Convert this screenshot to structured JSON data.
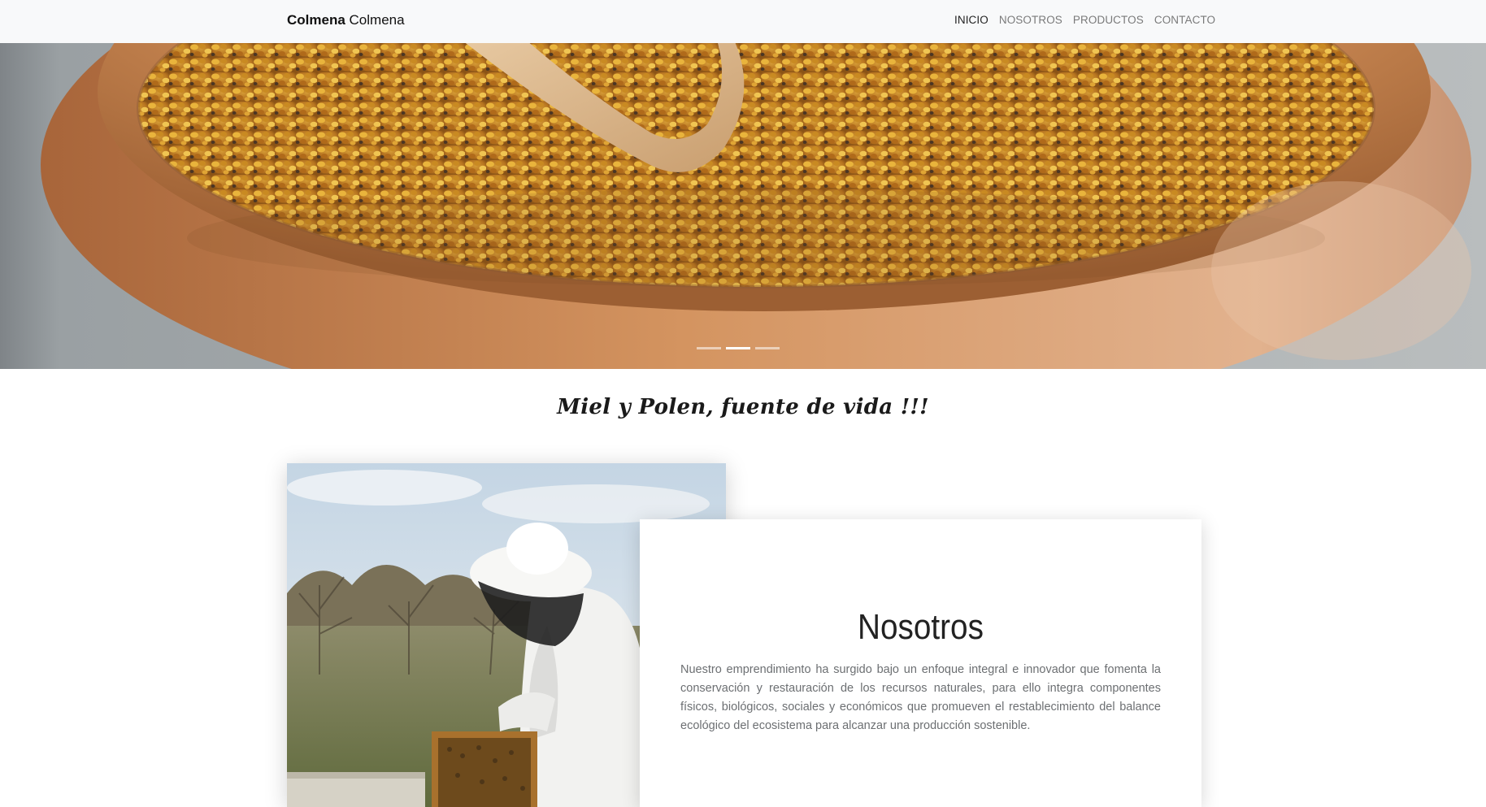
{
  "navbar": {
    "brand_bold": "Colmena",
    "brand_rest": "Colmena",
    "links": [
      {
        "label": "INICIO",
        "active": true
      },
      {
        "label": "NOSOTROS",
        "active": false
      },
      {
        "label": "PRODUCTOS",
        "active": false
      },
      {
        "label": "CONTACTO",
        "active": false
      }
    ]
  },
  "carousel": {
    "slide_count": 3,
    "active_index": 1
  },
  "tagline": "Miel y Polen, fuente de vida !!!",
  "about": {
    "title": "Nosotros",
    "body": "Nuestro emprendimiento ha surgido bajo un enfoque integral e innovador que fomenta la conservación y restauración de los recursos naturales, para ello integra componentes físicos, biológicos, sociales y económicos que promueven el restablecimiento del balance ecológico del ecosistema para alcanzar una producción sostenible."
  },
  "colors": {
    "navbar_bg": "#f8f9fa",
    "nav_active": "#222222",
    "nav_inactive": "#7a7a7a",
    "bowl_wood": "#c98a55",
    "pollen": "#d9a43c"
  }
}
